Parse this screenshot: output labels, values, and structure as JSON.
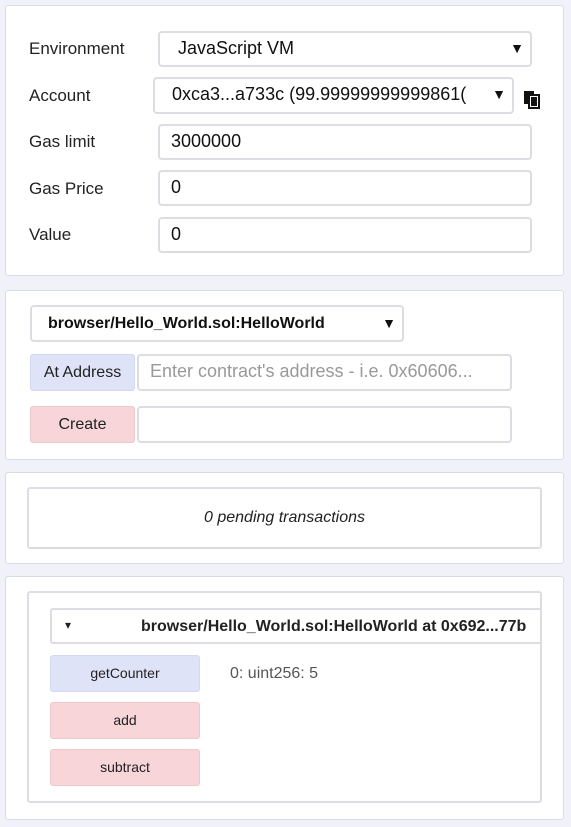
{
  "settings": {
    "environment": {
      "label": "Environment",
      "value": "JavaScript VM",
      "arrow": "▼"
    },
    "account": {
      "label": "Account",
      "value": "0xca3...a733c (99.99999999999861(",
      "arrow": "▼",
      "icon": "clipboard-icon"
    },
    "gas_limit": {
      "label": "Gas limit",
      "value": "3000000"
    },
    "gas_price": {
      "label": "Gas Price",
      "value": "0"
    },
    "value": {
      "label": "Value",
      "value": "0"
    }
  },
  "contract": {
    "selected": "browser/Hello_World.sol:HelloWorld",
    "arrow": "▼",
    "at_address_label": "At Address",
    "address_placeholder": "Enter contract's address - i.e. 0x60606...",
    "create_label": "Create",
    "create_args": ""
  },
  "pending": {
    "text": "0 pending transactions"
  },
  "instance": {
    "toggle": "▾",
    "title": "browser/Hello_World.sol:HelloWorld at 0x692...77b",
    "functions": [
      {
        "label": "getCounter",
        "color": "#dee3f7"
      },
      {
        "label": "add",
        "color": "#f7d5d8"
      },
      {
        "label": "subtract",
        "color": "#f7d5d8"
      }
    ],
    "getCounter_result": "0: uint256: 5"
  }
}
